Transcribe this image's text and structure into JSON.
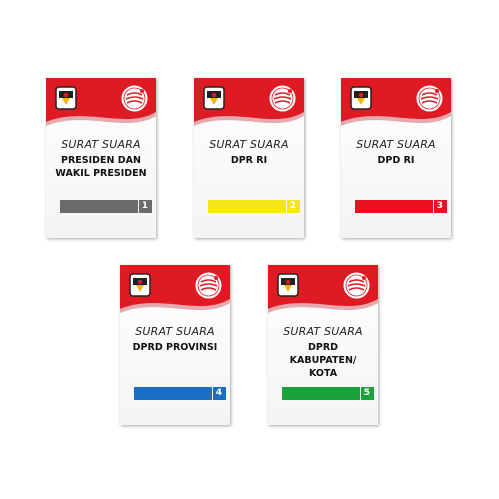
{
  "cards": [
    {
      "title": "SURAT SUARA",
      "subtitle": "PRESIDEN DAN\nWAKIL PRESIDEN",
      "number": "1",
      "color": "#6b6b6b"
    },
    {
      "title": "SURAT SUARA",
      "subtitle": "DPR RI",
      "number": "2",
      "color": "#f5e61a"
    },
    {
      "title": "SURAT SUARA",
      "subtitle": "DPD RI",
      "number": "3",
      "color": "#e8101e"
    },
    {
      "title": "SURAT SUARA",
      "subtitle": "DPRD PROVINSI",
      "number": "4",
      "color": "#1a6fc4"
    },
    {
      "title": "SURAT SUARA",
      "subtitle": "DPRD\nKABUPATEN/\nKOTA",
      "number": "5",
      "color": "#1aa33c"
    }
  ],
  "colors": {
    "header_red": "#e01a22",
    "header_dark": "#b8121a"
  },
  "icons": {
    "logo": "kpu-logo-icon",
    "seal": "pemilu-seal-icon"
  }
}
